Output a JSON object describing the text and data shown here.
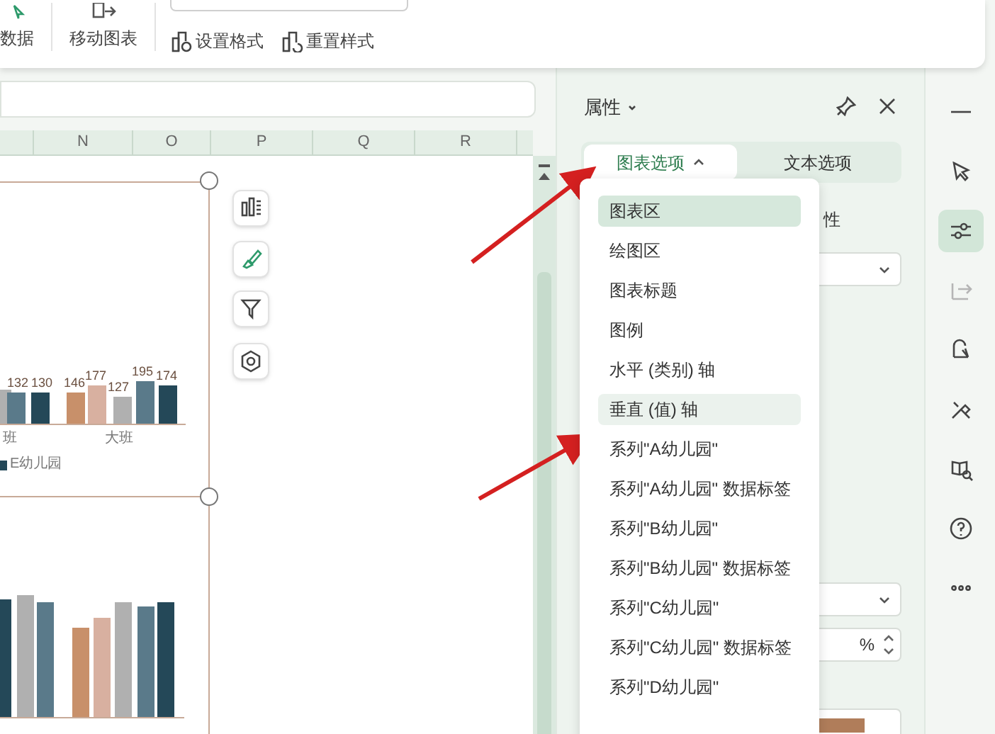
{
  "ribbon": {
    "items": [
      {
        "kind": "data",
        "label": "数据"
      },
      {
        "kind": "move",
        "label": "移动图表"
      }
    ],
    "actions": [
      {
        "kind": "format",
        "label": "设置格式"
      },
      {
        "kind": "reset",
        "label": "重置样式"
      }
    ]
  },
  "sheet": {
    "columns": [
      "N",
      "O",
      "P",
      "Q",
      "R"
    ]
  },
  "chart_top": {
    "value_labels": [
      "132",
      "130",
      "146",
      "177",
      "127",
      "195",
      "174"
    ],
    "category_labels": [
      "班",
      "大班"
    ],
    "legend": "E幼儿园"
  },
  "chart_tools": [
    {
      "kind": "elements"
    },
    {
      "kind": "style"
    },
    {
      "kind": "filter"
    },
    {
      "kind": "settings"
    }
  ],
  "panel": {
    "title": "属性",
    "tabs": [
      {
        "label": "图表选项",
        "selected": true
      },
      {
        "label": "文本选项",
        "selected": false
      }
    ],
    "behind_label": "性",
    "percent_unit": "%"
  },
  "menu": {
    "items": [
      {
        "label": "图表区",
        "selected": true,
        "hovered": false
      },
      {
        "label": "绘图区",
        "selected": false,
        "hovered": false
      },
      {
        "label": "图表标题",
        "selected": false,
        "hovered": false
      },
      {
        "label": "图例",
        "selected": false,
        "hovered": false
      },
      {
        "label": "水平 (类别) 轴",
        "selected": false,
        "hovered": false
      },
      {
        "label": "垂直 (值) 轴",
        "selected": false,
        "hovered": true
      },
      {
        "label": "系列\"A幼儿园\"",
        "selected": false,
        "hovered": false
      },
      {
        "label": "系列\"A幼儿园\" 数据标签",
        "selected": false,
        "hovered": false
      },
      {
        "label": "系列\"B幼儿园\"",
        "selected": false,
        "hovered": false
      },
      {
        "label": "系列\"B幼儿园\" 数据标签",
        "selected": false,
        "hovered": false
      },
      {
        "label": "系列\"C幼儿园\"",
        "selected": false,
        "hovered": false
      },
      {
        "label": "系列\"C幼儿园\" 数据标签",
        "selected": false,
        "hovered": false
      },
      {
        "label": "系列\"D幼儿园\"",
        "selected": false,
        "hovered": false
      }
    ]
  },
  "right_toolbar": [
    {
      "kind": "minimize",
      "selected": false,
      "disabled": false
    },
    {
      "kind": "select",
      "selected": false,
      "disabled": false
    },
    {
      "kind": "properties",
      "selected": true,
      "disabled": false
    },
    {
      "kind": "swap",
      "selected": false,
      "disabled": true
    },
    {
      "kind": "shape",
      "selected": false,
      "disabled": false
    },
    {
      "kind": "tools",
      "selected": false,
      "disabled": false
    },
    {
      "kind": "book",
      "selected": false,
      "disabled": false
    },
    {
      "kind": "help",
      "selected": false,
      "disabled": false
    },
    {
      "kind": "more",
      "selected": false,
      "disabled": false
    }
  ]
}
